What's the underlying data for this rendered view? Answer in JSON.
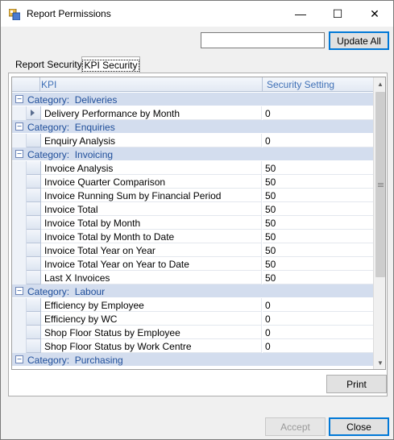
{
  "window": {
    "title": "Report Permissions",
    "minimize_glyph": "—",
    "maximize_glyph": "☐",
    "close_glyph": "✕"
  },
  "toolbar": {
    "search_value": "",
    "update_all_label": "Update All"
  },
  "tabs": [
    {
      "label": "Report Security"
    },
    {
      "label": "KPI Security"
    }
  ],
  "grid": {
    "columns": {
      "kpi": "KPI",
      "setting": "Security Setting"
    },
    "rows": [
      {
        "type": "category",
        "label": "Category:  Deliveries"
      },
      {
        "type": "item",
        "kpi": "Delivery Performance by Month",
        "setting": "0"
      },
      {
        "type": "category",
        "label": "Category:  Enquiries"
      },
      {
        "type": "item",
        "kpi": "Enquiry Analysis",
        "setting": "0"
      },
      {
        "type": "category",
        "label": "Category:  Invoicing"
      },
      {
        "type": "item",
        "kpi": "Invoice Analysis",
        "setting": "50"
      },
      {
        "type": "item",
        "kpi": "Invoice Quarter Comparison",
        "setting": "50"
      },
      {
        "type": "item",
        "kpi": "Invoice Running Sum by Financial Period",
        "setting": "50"
      },
      {
        "type": "item",
        "kpi": "Invoice Total",
        "setting": "50"
      },
      {
        "type": "item",
        "kpi": "Invoice Total by Month",
        "setting": "50"
      },
      {
        "type": "item",
        "kpi": "Invoice Total by Month to Date",
        "setting": "50"
      },
      {
        "type": "item",
        "kpi": "Invoice Total Year on Year",
        "setting": "50"
      },
      {
        "type": "item",
        "kpi": "Invoice Total Year on Year to Date",
        "setting": "50"
      },
      {
        "type": "item",
        "kpi": "Last X Invoices",
        "setting": "50"
      },
      {
        "type": "category",
        "label": "Category:  Labour"
      },
      {
        "type": "item",
        "kpi": "Efficiency by Employee",
        "setting": "0"
      },
      {
        "type": "item",
        "kpi": "Efficiency by WC",
        "setting": "0"
      },
      {
        "type": "item",
        "kpi": "Shop Floor Status by Employee",
        "setting": "0"
      },
      {
        "type": "item",
        "kpi": "Shop Floor Status by Work Centre",
        "setting": "0"
      },
      {
        "type": "category",
        "label": "Category:  Purchasing"
      }
    ]
  },
  "buttons": {
    "print": "Print",
    "accept": "Accept",
    "close": "Close"
  },
  "icons": {
    "collapse": "−",
    "scroll_up": "▲",
    "scroll_down": "▼"
  }
}
